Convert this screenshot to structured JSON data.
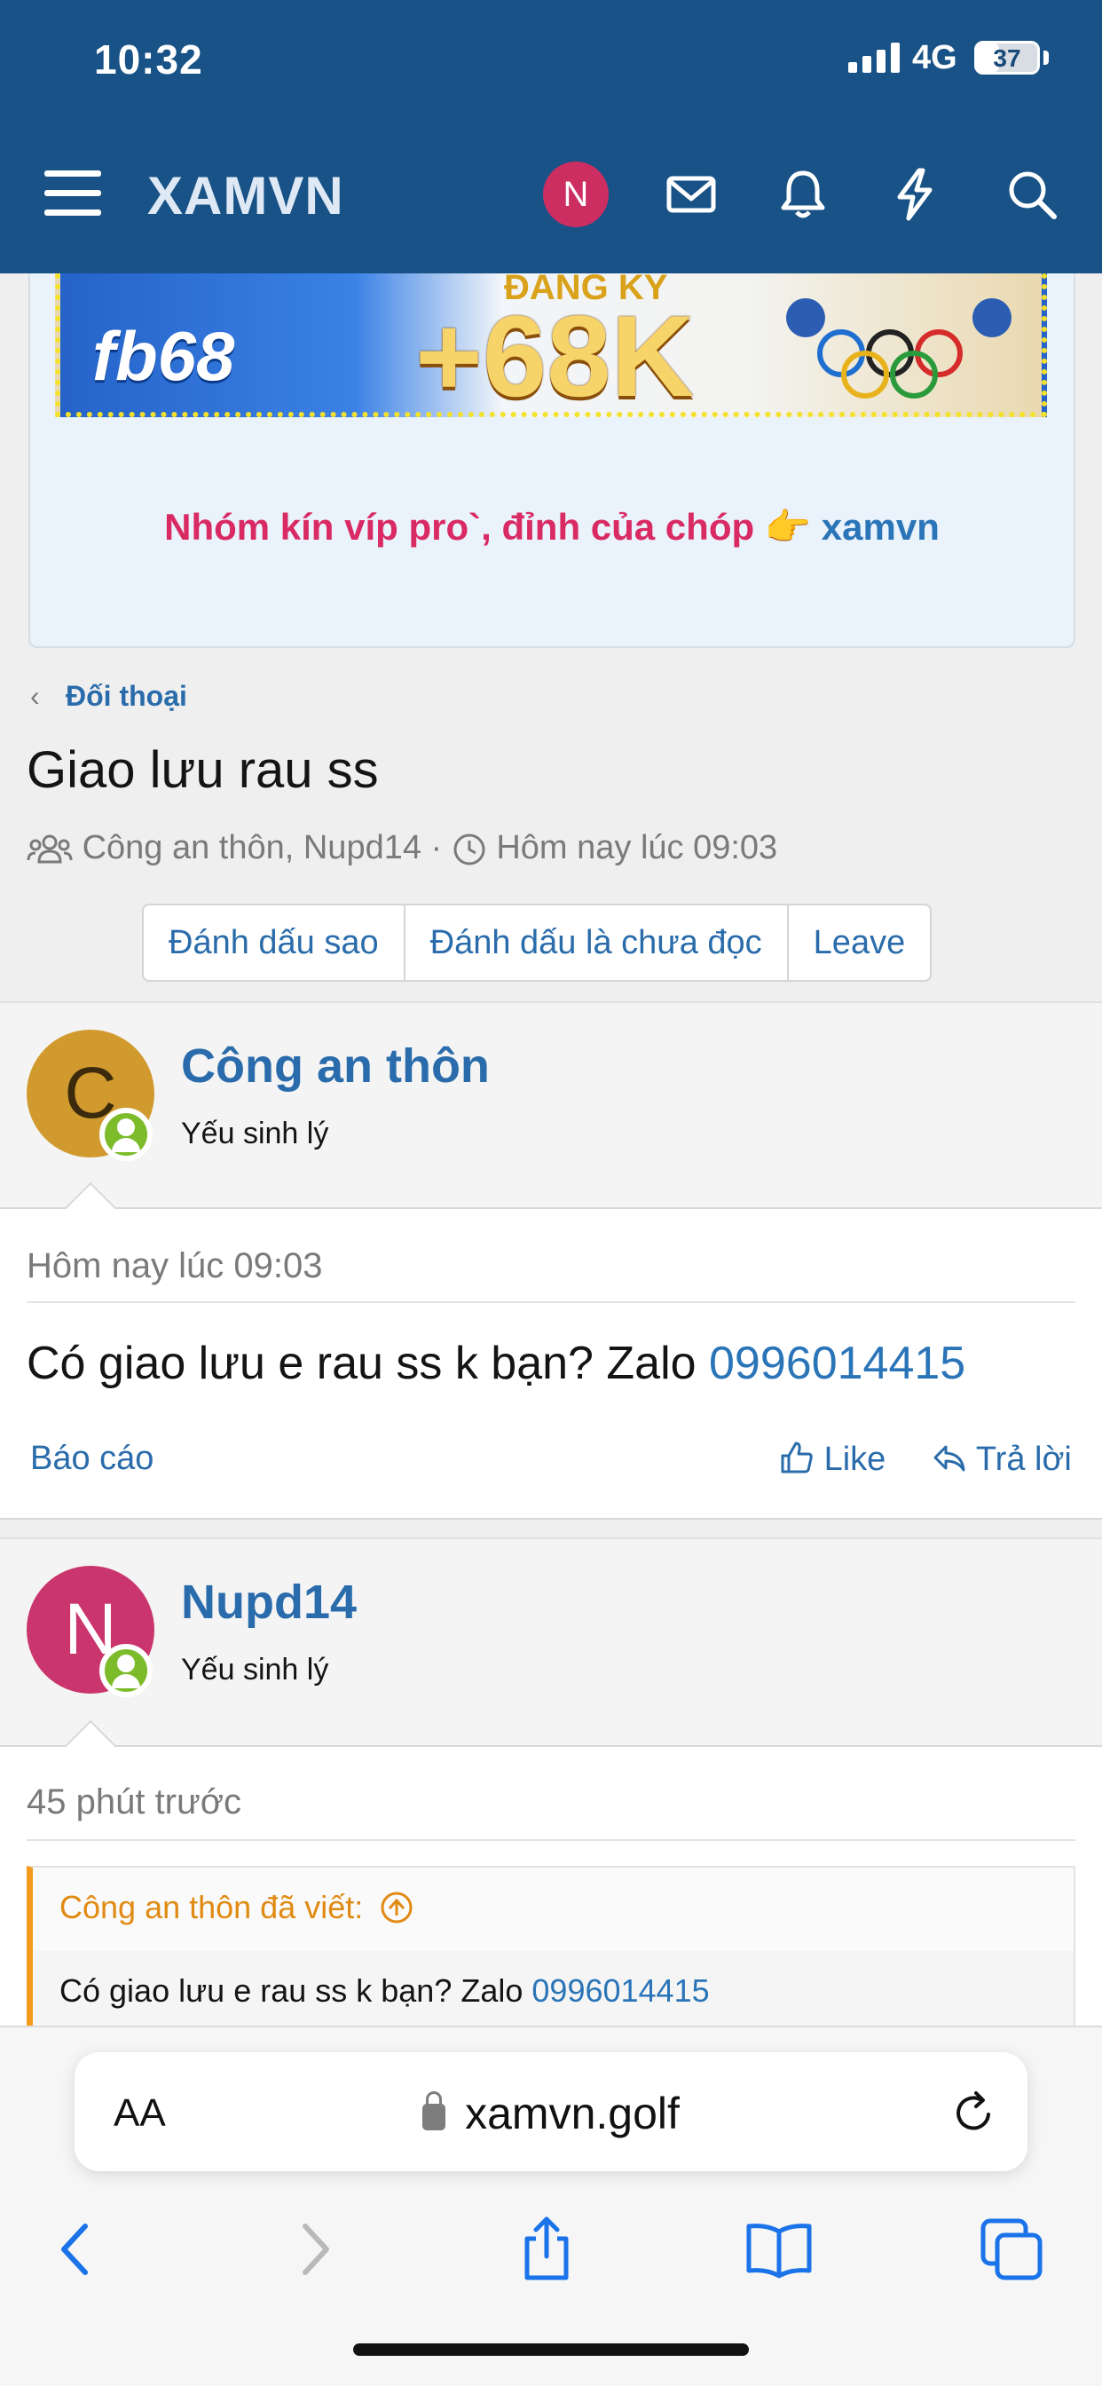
{
  "status": {
    "time": "10:32",
    "network": "4G",
    "battery": "37",
    "battery_level": 0.37
  },
  "header": {
    "brand": "XAMVN",
    "avatar_letter": "N"
  },
  "ad": {
    "logo_text": "fb68",
    "small_text": "ĐĂNG KÝ",
    "big_text": "+68K",
    "tagline_pink": "Nhóm kín víp pro`, đỉnh của chóp",
    "tagline_emoji": "👉",
    "tagline_link": "xamvn"
  },
  "breadcrumb": {
    "label": "Đối thoại"
  },
  "page": {
    "title": "Giao lưu rau ss",
    "participants": "Công an thôn, Nupd14",
    "separator": "·",
    "time": "Hôm nay lúc 09:03"
  },
  "actions": {
    "star": "Đánh dấu sao",
    "unread": "Đánh dấu là chưa đọc",
    "leave": "Leave"
  },
  "messages": [
    {
      "avatar_letter": "C",
      "avatar_color": "#d19a2e",
      "username": "Công an thôn",
      "role": "Yếu sinh lý",
      "time": "Hôm nay lúc 09:03",
      "text": "Có giao lưu e rau ss k bạn? Zalo",
      "phone": "0996014415",
      "report": "Báo cáo",
      "like": "Like",
      "reply": "Trả lời"
    },
    {
      "avatar_letter": "N",
      "avatar_color": "#c9356c",
      "username": "Nupd14",
      "role": "Yếu sinh lý",
      "time": "45 phút trước",
      "quote_author": "Công an thôn đã viết:",
      "quote_text": "Có giao lưu e rau ss k bạn? Zalo",
      "quote_phone": "0996014415"
    }
  ],
  "browser": {
    "aa_label": "AA",
    "url": "xamvn.golf"
  },
  "colors": {
    "header": "#185286",
    "link": "#2a6cab",
    "online": "#7cbb2a",
    "quote_accent": "#f49b1c"
  }
}
